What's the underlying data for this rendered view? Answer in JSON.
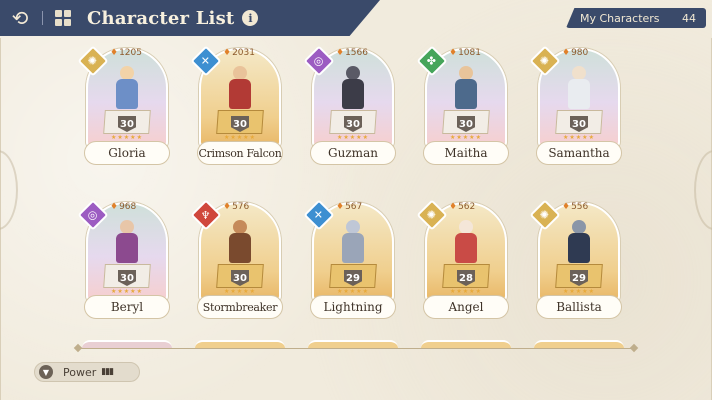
{
  "header": {
    "title": "Character List",
    "back_icon": "back-arrow-icon",
    "home_icon": "grid-home-icon",
    "info_icon": "info-icon",
    "info_symbol": "i",
    "back_symbol": "⟲"
  },
  "my_characters": {
    "label": "My Characters",
    "count": "44"
  },
  "power_sort": {
    "label": "Power",
    "sort_symbol": "▮▮▮"
  },
  "characters": [
    {
      "name": "Gloria",
      "power": "1205",
      "level": "30",
      "element": "light",
      "element_symbol": "✺",
      "stars": "★★★★★"
    },
    {
      "name": "Crimson Falcon",
      "power": "2031",
      "level": "30",
      "element": "water",
      "element_symbol": "✕",
      "stars": "★★★★★"
    },
    {
      "name": "Guzman",
      "power": "1566",
      "level": "30",
      "element": "dark",
      "element_symbol": "◎",
      "stars": "★★★★★"
    },
    {
      "name": "Maitha",
      "power": "1081",
      "level": "30",
      "element": "earth",
      "element_symbol": "✤",
      "stars": "★★★★★"
    },
    {
      "name": "Samantha",
      "power": "980",
      "level": "30",
      "element": "light",
      "element_symbol": "✺",
      "stars": "★★★★★"
    },
    {
      "name": "Beryl",
      "power": "968",
      "level": "30",
      "element": "dark",
      "element_symbol": "◎",
      "stars": "★★★★★"
    },
    {
      "name": "Stormbreaker",
      "power": "576",
      "level": "30",
      "element": "fire",
      "element_symbol": "♆",
      "stars": "★★★★★"
    },
    {
      "name": "Lightning",
      "power": "567",
      "level": "29",
      "element": "water",
      "element_symbol": "✕",
      "stars": "★★★★★"
    },
    {
      "name": "Angel",
      "power": "562",
      "level": "28",
      "element": "light",
      "element_symbol": "✺",
      "stars": "★★★★★"
    },
    {
      "name": "Ballista",
      "power": "556",
      "level": "29",
      "element": "light",
      "element_symbol": "✺",
      "stars": "★★★★★"
    }
  ],
  "colors": {
    "header_bg": "#3a4a6a",
    "page_bg": "#f1ebdd",
    "light": "#d9b253",
    "water": "#3d8fd1",
    "dark": "#9c5cc2",
    "earth": "#45a55a",
    "fire": "#d0473c"
  }
}
